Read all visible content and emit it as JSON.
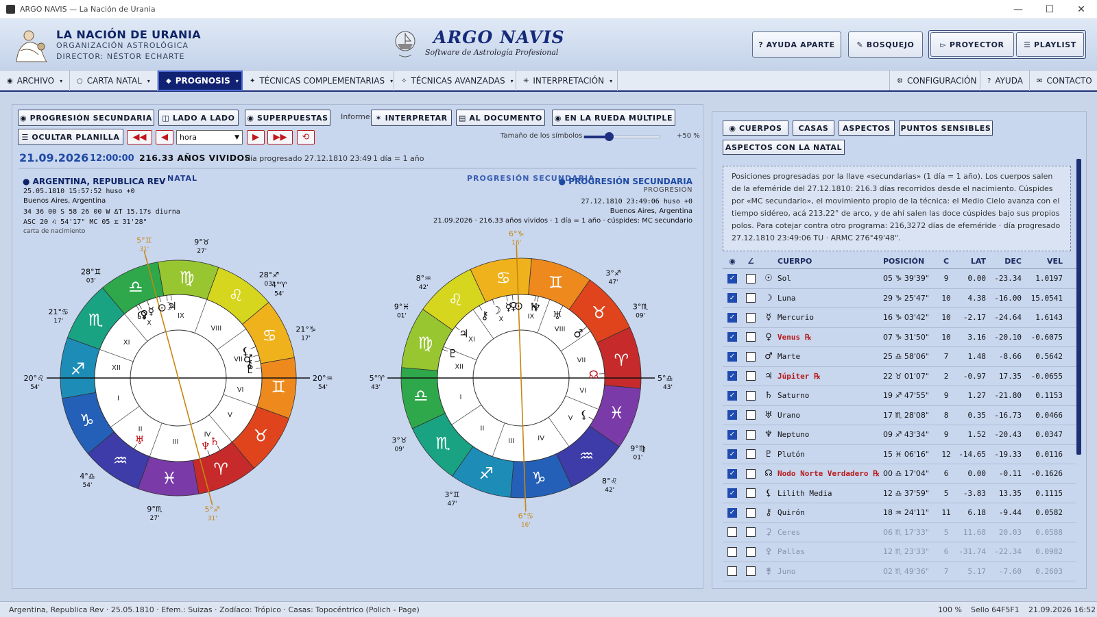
{
  "window": {
    "title": "ARGO NAVIS — La Nación de Urania",
    "min": "—",
    "max": "☐",
    "close": "✕"
  },
  "header": {
    "org_title": "LA NACIÓN DE URANIA",
    "org_sub": "ORGANIZACIÓN ASTROLÓGICA",
    "org_director": "DIRECTOR: NÉSTOR ECHARTE",
    "brand": "ARGO NAVIS",
    "brand_sub": "Software de Astrología Profesional",
    "btn_help": "? AYUDA APARTE",
    "btn_sketch": "✎ BOSQUEJO",
    "btn_projector": "▻ PROYECTOR",
    "btn_playlist": "☰ PLAYLIST"
  },
  "menu": {
    "archivo": "ARCHIVO",
    "carta_natal": "CARTA NATAL",
    "prognosis": "PROGNOSIS",
    "tecnicas_comp": "TÉCNICAS COMPLEMENTARIAS",
    "tecnicas_av": "TÉCNICAS AVANZADAS",
    "interpretacion": "INTERPRETACIÓN",
    "configuracion": "CONFIGURACIÓN",
    "ayuda": "AYUDA",
    "contacto": "CONTACTO"
  },
  "left": {
    "btn_progresion": "◉ PROGRESIÓN SECUNDARIA",
    "btn_lado": "◫ LADO A LADO",
    "btn_superpuestas": "◉ SUPERPUESTAS",
    "informe_label": "Informe:",
    "btn_interpretar": "✶ INTERPRETAR",
    "btn_documento": "▤ AL DOCUMENTO",
    "btn_rueda": "◉ EN LA RUEDA MÚLTIPLE",
    "btn_ocultar": "☰ OCULTAR PLANILLA",
    "unit_select": "hora",
    "size_label": "Tamaño de los símbolos",
    "size_value": "+50 %",
    "date": "21.09.2026",
    "time": "12:00:00",
    "years": "216.33 AÑOS VIVIDOS",
    "prog_day": "día progresado 27.12.1810 23:49",
    "ratio": "1 día = 1 año"
  },
  "natal": {
    "name": "● ARGENTINA, REPUBLICA REV",
    "tag": "NATAL",
    "l1": "25.05.1810 15:57:52 huso +0",
    "l2": "Buenos Aires, Argentina",
    "l3": "34 36 00 S 58 26 00 W ΔT 15.17s diurna",
    "l4": "ASC 20 ♌ 54'17\" MC 05 ♊ 31'28\"",
    "l5": "carta de nacimiento"
  },
  "prog": {
    "tag": "PROGRESIÓN SECUNDARIA",
    "name": "● PROGRESIÓN SECUNDARIA",
    "sub": "PROGRESIÓN",
    "l1": "27.12.1810 23:49:06 huso +0",
    "l2": "Buenos Aires, Argentina",
    "l3": "21.09.2026 · 216.33 años vividos · 1 día = 1 año · cúspides: MC secundario"
  },
  "right": {
    "tab_cuerpos": "◉ CUERPOS",
    "tab_casas": "CASAS",
    "tab_aspectos": "ASPECTOS",
    "tab_puntos": "PUNTOS SENSIBLES",
    "tab_natal": "ASPECTOS CON LA NATAL",
    "info": "Posiciones progresadas por la llave «secundarias» (1 día = 1 año). Los cuerpos salen de la efeméride del 27.12.1810: 216.3 días recorridos desde el nacimiento. Cúspides por «MC secundario», el movimiento propio de la técnica: el Medio Cielo avanza con el tiempo sidéreo, acá 213.22° de arco, y de ahí salen las doce cúspides bajo sus propios polos. Para cotejar contra otro programa: 216,3272 días de efeméride · día progresado 27.12.1810 23:49:06 TU · ARMC 276°49'48\".",
    "columns": {
      "vis": "◉",
      "ang": "∠",
      "cuerpo": "CUERPO",
      "pos": "POSICIÓN",
      "c": "C",
      "lat": "LAT",
      "dec": "DEC",
      "vel": "VEL"
    },
    "rows": [
      {
        "glyph": "☉",
        "name": "Sol",
        "pos": "05 ♑ 39'39\"",
        "c": "9",
        "lat": "0.00",
        "dec": "-23.34",
        "vel": "1.0197",
        "on": true,
        "retro": false
      },
      {
        "glyph": "☽",
        "name": "Luna",
        "pos": "29 ♑ 25'47\"",
        "c": "10",
        "lat": "4.38",
        "dec": "-16.00",
        "vel": "15.0541",
        "on": true,
        "retro": false
      },
      {
        "glyph": "☿",
        "name": "Mercurio",
        "pos": "16 ♑ 03'42\"",
        "c": "10",
        "lat": "-2.17",
        "dec": "-24.64",
        "vel": "1.6143",
        "on": true,
        "retro": false
      },
      {
        "glyph": "♀",
        "name": "Venus ℞",
        "pos": "07 ♑ 31'50\"",
        "c": "10",
        "lat": "3.16",
        "dec": "-20.10",
        "vel": "-0.6075",
        "on": true,
        "retro": true
      },
      {
        "glyph": "♂",
        "name": "Marte",
        "pos": "25 ♎ 58'06\"",
        "c": "7",
        "lat": "1.48",
        "dec": "-8.66",
        "vel": "0.5642",
        "on": true,
        "retro": false
      },
      {
        "glyph": "♃",
        "name": "Júpiter ℞",
        "pos": "22 ♉ 01'07\"",
        "c": "2",
        "lat": "-0.97",
        "dec": "17.35",
        "vel": "-0.0655",
        "on": true,
        "retro": true
      },
      {
        "glyph": "♄",
        "name": "Saturno",
        "pos": "19 ♐ 47'55\"",
        "c": "9",
        "lat": "1.27",
        "dec": "-21.80",
        "vel": "0.1153",
        "on": true,
        "retro": false
      },
      {
        "glyph": "♅",
        "name": "Urano",
        "pos": "17 ♏ 28'08\"",
        "c": "8",
        "lat": "0.35",
        "dec": "-16.73",
        "vel": "0.0466",
        "on": true,
        "retro": false
      },
      {
        "glyph": "♆",
        "name": "Neptuno",
        "pos": "09 ♐ 43'34\"",
        "c": "9",
        "lat": "1.52",
        "dec": "-20.43",
        "vel": "0.0347",
        "on": true,
        "retro": false
      },
      {
        "glyph": "♇",
        "name": "Plutón",
        "pos": "15 ♓ 06'16\"",
        "c": "12",
        "lat": "-14.65",
        "dec": "-19.33",
        "vel": "0.0116",
        "on": true,
        "retro": false
      },
      {
        "glyph": "☊",
        "name": "Nodo Norte Verdadero ℞",
        "pos": "00 ♎ 17'04\"",
        "c": "6",
        "lat": "0.00",
        "dec": "-0.11",
        "vel": "-0.1626",
        "on": true,
        "retro": true
      },
      {
        "glyph": "⚸",
        "name": "Lilith Media",
        "pos": "12 ♎ 37'59\"",
        "c": "5",
        "lat": "-3.83",
        "dec": "13.35",
        "vel": "0.1115",
        "on": true,
        "retro": false
      },
      {
        "glyph": "⚷",
        "name": "Quirón",
        "pos": "18 ♒ 24'11\"",
        "c": "11",
        "lat": "6.18",
        "dec": "-9.44",
        "vel": "0.0582",
        "on": true,
        "retro": false
      },
      {
        "glyph": "⚳",
        "name": "Ceres",
        "pos": "06 ♏ 17'33\"",
        "c": "5",
        "lat": "11.68",
        "dec": "20.03",
        "vel": "0.0588",
        "on": false,
        "retro": false,
        "dim": true
      },
      {
        "glyph": "⚴",
        "name": "Pallas",
        "pos": "12 ♏ 23'33\"",
        "c": "6",
        "lat": "-31.74",
        "dec": "-22.34",
        "vel": "0.0982",
        "on": false,
        "retro": false,
        "dim": true
      },
      {
        "glyph": "⚵",
        "name": "Juno",
        "pos": "02 ♏ 49'36\"",
        "c": "7",
        "lat": "5.17",
        "dec": "-7.60",
        "vel": "0.2603",
        "on": false,
        "retro": false,
        "dim": true
      }
    ]
  },
  "natal_wheel": {
    "asc": "20°♌",
    "asc_min": "54'",
    "dsc": "20°♒",
    "dsc_min": "54'",
    "mc": "5°♊",
    "mc_min": "31'",
    "ic": "5°♐",
    "ic_min": "31'",
    "cusps": [
      {
        "t": "9°♉",
        "m": "27'"
      },
      {
        "t": "28°♊",
        "m": "03'"
      },
      {
        "t": "21°♋",
        "m": "17'"
      },
      {
        "t": "4°♈",
        "m": "54'"
      },
      {
        "t": "21°♑",
        "m": "17'"
      },
      {
        "t": "28°♐",
        "m": "03'"
      },
      {
        "t": "9°♏",
        "m": "27'"
      },
      {
        "t": "4°♎",
        "m": "54'"
      }
    ],
    "houses": [
      "I",
      "II",
      "III",
      "IV",
      "V",
      "VI",
      "VII",
      "VIII",
      "IX",
      "X",
      "XI",
      "XII"
    ],
    "planets": [
      "⊙",
      "☽",
      "☿",
      "♀",
      "♂",
      "♃",
      "♄",
      "♅",
      "♆",
      "♇",
      "☊",
      "⚸",
      "⚷"
    ]
  },
  "prog_wheel": {
    "asc": "5°♈",
    "asc_min": "43'",
    "dsc": "5°♎",
    "dsc_min": "43'",
    "mc": "6°♑",
    "mc_min": "16'",
    "ic": "6°♋",
    "ic_min": "16'",
    "cusps": [
      {
        "t": "8°♒",
        "m": "42'"
      },
      {
        "t": "3°♐",
        "m": "47'"
      },
      {
        "t": "9°♓",
        "m": "01'"
      },
      {
        "t": "3°♏",
        "m": "09'"
      },
      {
        "t": "3°♉",
        "m": "09'"
      },
      {
        "t": "9°♍",
        "m": "01'"
      },
      {
        "t": "3°♊",
        "m": "47'"
      },
      {
        "t": "8°♌",
        "m": "42'"
      }
    ],
    "houses": [
      "I",
      "II",
      "III",
      "IV",
      "V",
      "VI",
      "VII",
      "VIII",
      "IX",
      "X",
      "XI",
      "XII"
    ],
    "planets": [
      "⊙",
      "☽",
      "☿",
      "♀",
      "♂",
      "♃",
      "♄",
      "♅",
      "♆",
      "♇",
      "☊",
      "⚸",
      "⚷"
    ]
  },
  "signs": [
    "♈",
    "♉",
    "♊",
    "♋",
    "♌",
    "♍",
    "♎",
    "♏",
    "♐",
    "♑",
    "♒",
    "♓"
  ],
  "colors": {
    "navy": "#112273",
    "orange_axis": "#c8860f",
    "red": "#c4161c"
  },
  "status": {
    "left": "Argentina, Republica Rev · 25.05.1810 · Efem.: Suizas · Zodíaco: Trópico · Casas: Topocéntrico (Polich - Page)",
    "zoom": "100 %",
    "seal": "Sello 64F5F1",
    "clock": "21.09.2026 16:52"
  }
}
